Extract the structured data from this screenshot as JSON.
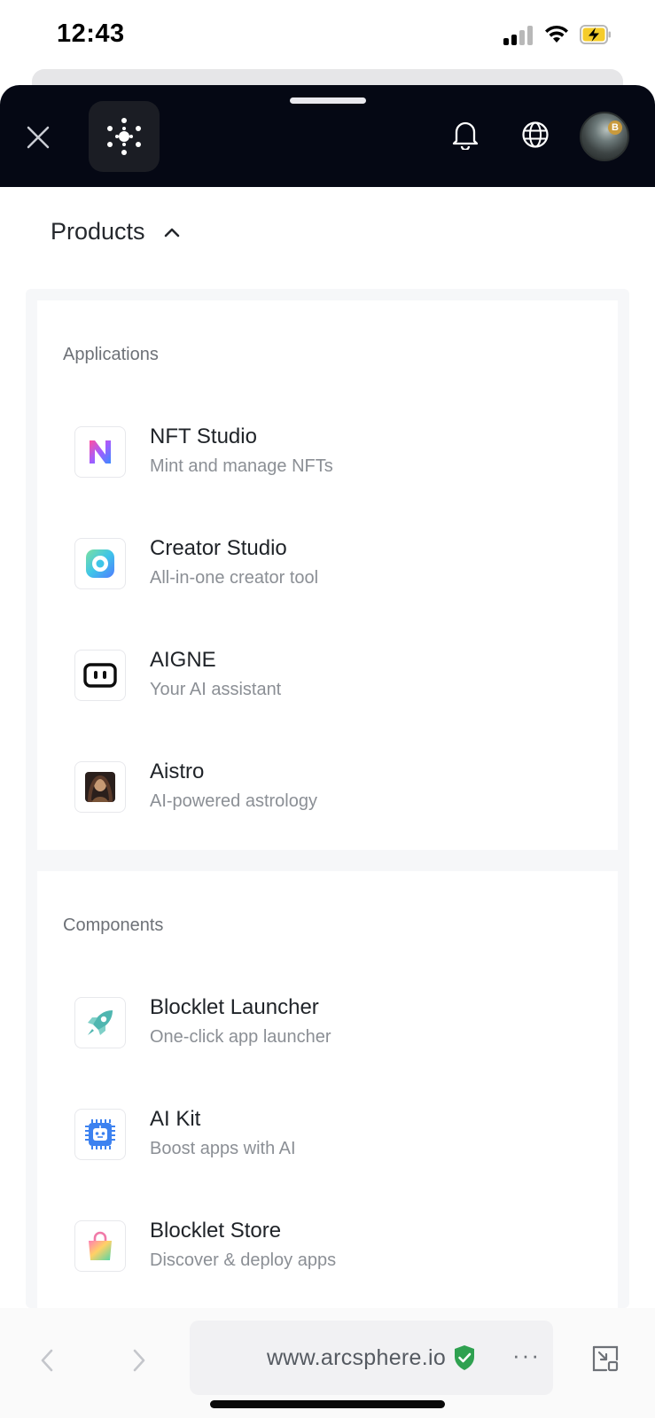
{
  "status_bar": {
    "time": "12:43"
  },
  "header": {
    "close_label": "Close",
    "logo_alt": "ArcSphere logo",
    "icons": [
      "close-icon",
      "bell-icon",
      "globe-icon",
      "avatar"
    ]
  },
  "menu": {
    "toggle_label": "Products",
    "expanded": true,
    "sections": [
      {
        "title": "Applications",
        "items": [
          {
            "title": "NFT Studio",
            "desc": "Mint and manage NFTs",
            "icon": "nft-studio-icon"
          },
          {
            "title": "Creator Studio",
            "desc": "All-in-one creator tool",
            "icon": "creator-studio-icon"
          },
          {
            "title": "AIGNE",
            "desc": "Your AI assistant",
            "icon": "aigne-icon"
          },
          {
            "title": "Aistro",
            "desc": "AI-powered astrology",
            "icon": "aistro-icon"
          }
        ]
      },
      {
        "title": "Components",
        "items": [
          {
            "title": "Blocklet Launcher",
            "desc": "One-click app launcher",
            "icon": "rocket-icon"
          },
          {
            "title": "AI Kit",
            "desc": "Boost apps with AI",
            "icon": "robot-chip-icon"
          },
          {
            "title": "Blocklet Store",
            "desc": "Discover & deploy apps",
            "icon": "shopping-bag-icon"
          }
        ]
      }
    ]
  },
  "browser": {
    "url": "www.arcsphere.io",
    "more_label": "···",
    "colors": {
      "secure_shield": "#2fa150",
      "header_bg": "#050814"
    }
  }
}
